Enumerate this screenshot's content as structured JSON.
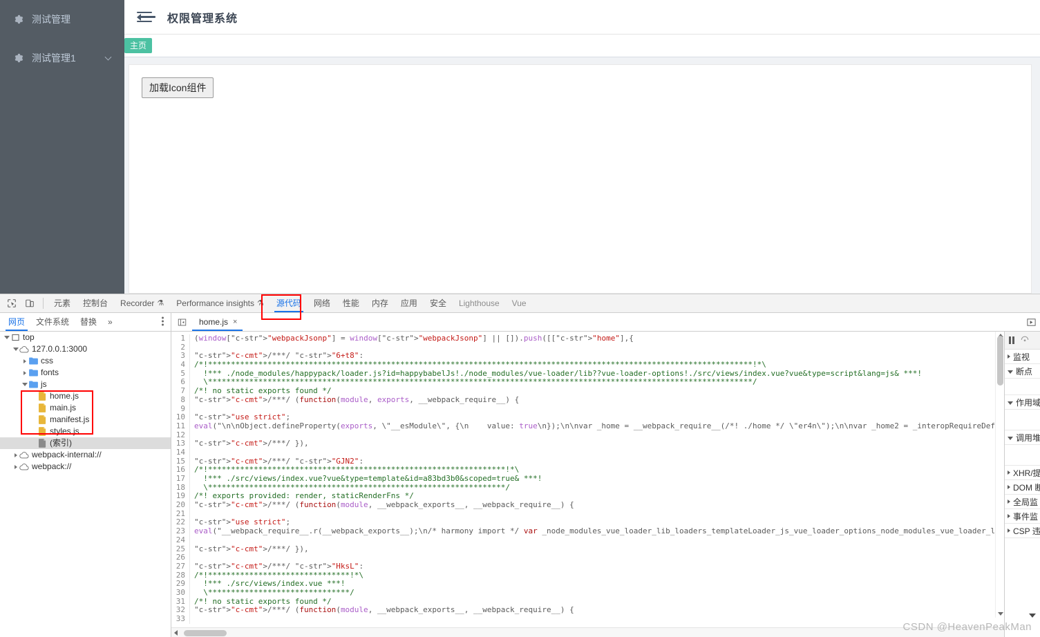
{
  "app": {
    "sidebar": {
      "items": [
        {
          "label": "测试管理",
          "icon": "gear-icon",
          "has_arrow": false
        },
        {
          "label": "测试管理1",
          "icon": "gear-icon",
          "has_arrow": true
        }
      ],
      "bg_color": "#545c64",
      "text_color": "#bfcbd9"
    },
    "header": {
      "title": "权限管理系统",
      "fold_icon": "fold-menu-icon"
    },
    "tags": [
      {
        "label": "主页",
        "active": true,
        "color": "#4cc1a2"
      }
    ],
    "content": {
      "button_label": "加载Icon组件"
    }
  },
  "devtools": {
    "toolbar": {
      "inspect_icon": "inspect-element-icon",
      "device_icon": "device-toolbar-icon",
      "tabs": [
        {
          "label": "元素",
          "selected": false,
          "dim": false,
          "flask": false
        },
        {
          "label": "控制台",
          "selected": false,
          "dim": false,
          "flask": false
        },
        {
          "label": "Recorder",
          "selected": false,
          "dim": false,
          "flask": true
        },
        {
          "label": "Performance insights",
          "selected": false,
          "dim": false,
          "flask": true
        },
        {
          "label": "源代码",
          "selected": true,
          "dim": false,
          "flask": false
        },
        {
          "label": "网络",
          "selected": false,
          "dim": false,
          "flask": false
        },
        {
          "label": "性能",
          "selected": false,
          "dim": false,
          "flask": false
        },
        {
          "label": "内存",
          "selected": false,
          "dim": false,
          "flask": false
        },
        {
          "label": "应用",
          "selected": false,
          "dim": false,
          "flask": false
        },
        {
          "label": "安全",
          "selected": false,
          "dim": false,
          "flask": false
        },
        {
          "label": "Lighthouse",
          "selected": false,
          "dim": true,
          "flask": false
        },
        {
          "label": "Vue",
          "selected": false,
          "dim": true,
          "flask": false
        }
      ],
      "highlight_color": "#ff0000"
    },
    "nav_subtabs": [
      {
        "label": "网页",
        "selected": true
      },
      {
        "label": "文件系统",
        "selected": false
      },
      {
        "label": "替换",
        "selected": false
      },
      {
        "label": "»",
        "selected": false
      }
    ],
    "editor_tabs": [
      {
        "label": "home.js",
        "active": true,
        "close": "×"
      }
    ],
    "file_tree": [
      {
        "label": "top",
        "depth": 0,
        "icon": "frame-icon",
        "twisty": "open",
        "selected": false
      },
      {
        "label": "127.0.0.1:3000",
        "depth": 1,
        "icon": "cloud-icon",
        "twisty": "open",
        "selected": false
      },
      {
        "label": "css",
        "depth": 2,
        "icon": "folder-icon",
        "twisty": "closed",
        "selected": false
      },
      {
        "label": "fonts",
        "depth": 2,
        "icon": "folder-icon",
        "twisty": "closed",
        "selected": false
      },
      {
        "label": "js",
        "depth": 2,
        "icon": "folder-icon",
        "twisty": "open",
        "selected": false
      },
      {
        "label": "home.js",
        "depth": 3,
        "icon": "js-file-icon",
        "twisty": "none",
        "selected": false
      },
      {
        "label": "main.js",
        "depth": 3,
        "icon": "js-file-icon",
        "twisty": "none",
        "selected": false
      },
      {
        "label": "manifest.js",
        "depth": 3,
        "icon": "js-file-icon",
        "twisty": "none",
        "selected": false
      },
      {
        "label": "styles.js",
        "depth": 3,
        "icon": "js-file-icon",
        "twisty": "none",
        "selected": false
      },
      {
        "label": "(索引)",
        "depth": 3,
        "icon": "doc-icon",
        "twisty": "none",
        "selected": true
      },
      {
        "label": "webpack-internal://",
        "depth": 1,
        "icon": "cloud-icon",
        "twisty": "closed",
        "selected": false
      },
      {
        "label": "webpack://",
        "depth": 1,
        "icon": "cloud-icon",
        "twisty": "closed",
        "selected": false
      }
    ],
    "code_lines": [
      {
        "n": 1,
        "text": "(window[\"webpackJsonp\"] = window[\"webpackJsonp\"] || []).push([[\"home\"],{"
      },
      {
        "n": 2,
        "text": ""
      },
      {
        "n": 3,
        "text": "/***/ \"6+t8\":"
      },
      {
        "n": 4,
        "text": "/*!***********************************************************************************************************************!*\\"
      },
      {
        "n": 5,
        "text": "  !*** ./node_modules/happypack/loader.js?id=happybabelJs!./node_modules/vue-loader/lib??vue-loader-options!./src/views/index.vue?vue&type=script&lang=js& ***!"
      },
      {
        "n": 6,
        "text": "  \\***********************************************************************************************************************/"
      },
      {
        "n": 7,
        "text": "/*! no static exports found */"
      },
      {
        "n": 8,
        "text": "/***/ (function(module, exports, __webpack_require__) {"
      },
      {
        "n": 9,
        "text": ""
      },
      {
        "n": 10,
        "text": "\"use strict\";"
      },
      {
        "n": 11,
        "text": "eval(\"\\n\\nObject.defineProperty(exports, \\\"__esModule\\\", {\\n    value: true\\n});\\n\\nvar _home = __webpack_require__(/*! ./home */ \\\"er4n\\\");\\n\\nvar _home2 = _interopRequireDefault(_home);\\n\\nfunc"
      },
      {
        "n": 12,
        "text": ""
      },
      {
        "n": 13,
        "text": "/***/ }),"
      },
      {
        "n": 14,
        "text": ""
      },
      {
        "n": 15,
        "text": "/***/ \"GJN2\":"
      },
      {
        "n": 16,
        "text": "/*!*****************************************************************!*\\"
      },
      {
        "n": 17,
        "text": "  !*** ./src/views/index.vue?vue&type=template&id=a83bd3b0&scoped=true& ***!"
      },
      {
        "n": 18,
        "text": "  \\*****************************************************************/"
      },
      {
        "n": 19,
        "text": "/*! exports provided: render, staticRenderFns */"
      },
      {
        "n": 20,
        "text": "/***/ (function(module, __webpack_exports__, __webpack_require__) {"
      },
      {
        "n": 21,
        "text": ""
      },
      {
        "n": 22,
        "text": "\"use strict\";"
      },
      {
        "n": 23,
        "text": "eval(\"__webpack_require__.r(__webpack_exports__);\\n/* harmony import */ var _node_modules_vue_loader_lib_loaders_templateLoader_js_vue_loader_options_node_modules_vue_loader_lib_index_js_vue_load"
      },
      {
        "n": 24,
        "text": ""
      },
      {
        "n": 25,
        "text": "/***/ }),"
      },
      {
        "n": 26,
        "text": ""
      },
      {
        "n": 27,
        "text": "/***/ \"HksL\":"
      },
      {
        "n": 28,
        "text": "/*!*******************************!*\\"
      },
      {
        "n": 29,
        "text": "  !*** ./src/views/index.vue ***!"
      },
      {
        "n": 30,
        "text": "  \\*******************************/"
      },
      {
        "n": 31,
        "text": "/*! no static exports found */"
      },
      {
        "n": 32,
        "text": "/***/ (function(module, __webpack_exports__, __webpack_require__) {"
      },
      {
        "n": 33,
        "text": ""
      }
    ],
    "debugger_sections": [
      {
        "label": "监视",
        "open": false,
        "body": false
      },
      {
        "label": "断点",
        "open": true,
        "body": true
      },
      {
        "label": "作用域",
        "open": true,
        "body": true
      },
      {
        "label": "调用堆",
        "open": true,
        "body": true
      },
      {
        "label": "XHR/提",
        "open": false,
        "body": false
      },
      {
        "label": "DOM 断",
        "open": false,
        "body": false
      },
      {
        "label": "全局监",
        "open": false,
        "body": false
      },
      {
        "label": "事件监",
        "open": false,
        "body": false
      },
      {
        "label": "CSP 违",
        "open": false,
        "body": false
      }
    ],
    "debugger_toolbar": {
      "pause_icon": "pause-script-icon",
      "stepover_icon": "step-over-icon"
    },
    "play_icon": "resume-icon"
  },
  "watermark": {
    "text": "CSDN @HeavenPeakMan"
  }
}
